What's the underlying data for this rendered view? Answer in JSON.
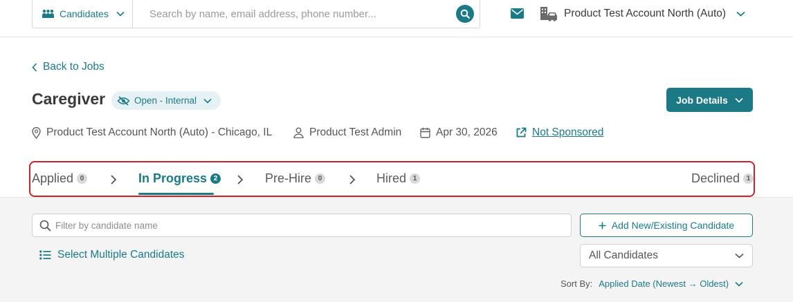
{
  "colors": {
    "accent": "#1b7a86",
    "highlight_outline": "#c9242b",
    "panel_bg": "#f4f4f4"
  },
  "header": {
    "candidates_select": "Candidates",
    "search_placeholder": "Search by name, email address, phone number...",
    "account_name": "Product Test Account North (Auto)",
    "icons": [
      "people-icon",
      "chevron-down-icon",
      "search-icon",
      "mail-icon",
      "building-car-icon"
    ]
  },
  "job": {
    "back_label": "Back to Jobs",
    "title": "Caregiver",
    "status": "Open - Internal",
    "job_details_button": "Job Details",
    "location": "Product Test Account North (Auto) - Chicago, IL",
    "recruiter": "Product Test Admin",
    "date": "Apr 30, 2026",
    "sponsorship": "Not Sponsored"
  },
  "tabs": [
    {
      "label": "Applied",
      "count": "0",
      "active": false
    },
    {
      "label": "In Progress",
      "count": "2",
      "active": true
    },
    {
      "label": "Pre-Hire",
      "count": "0",
      "active": false
    },
    {
      "label": "Hired",
      "count": "1",
      "active": false
    },
    {
      "label": "Declined",
      "count": "1",
      "active": false
    }
  ],
  "candidates_panel": {
    "filter_placeholder": "Filter by candidate name",
    "add_button": "Add New/Existing Candidate",
    "select_multiple": "Select Multiple Candidates",
    "filter_select": "All Candidates",
    "sort_label": "Sort By:",
    "sort_value": "Applied Date (Newest → Oldest)"
  }
}
